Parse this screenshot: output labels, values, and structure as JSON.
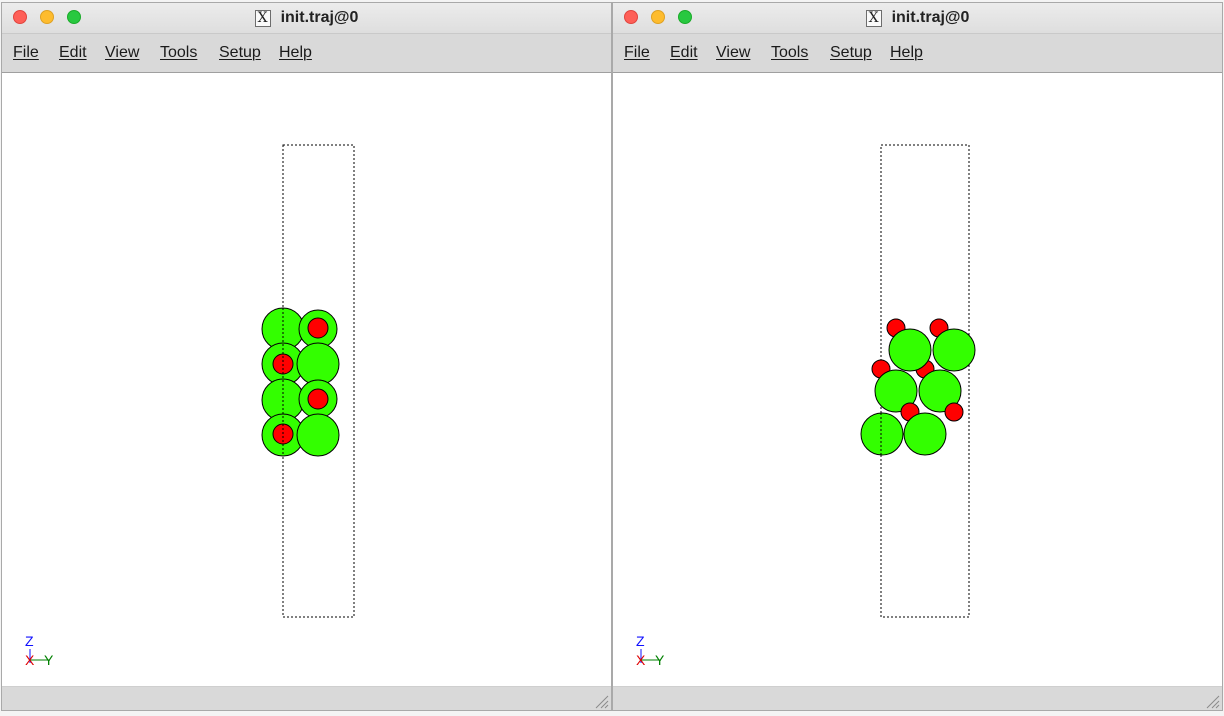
{
  "windows": {
    "left": {
      "title": "init.traj@0",
      "menu": [
        "File",
        "Edit",
        "View",
        "Tools",
        "Setup",
        "Help"
      ],
      "atoms": {
        "small_color": "#ff0000",
        "large_color": "#33ff00"
      },
      "axes": {
        "z": "Z",
        "x": "X",
        "y": "Y"
      }
    },
    "right": {
      "title": "init.traj@0",
      "menu": [
        "File",
        "Edit",
        "View",
        "Tools",
        "Setup",
        "Help"
      ],
      "atoms": {
        "small_color": "#ff0000",
        "large_color": "#33ff00"
      },
      "axes": {
        "z": "Z",
        "x": "X",
        "y": "Y"
      }
    }
  },
  "colors": {
    "close": "#fe5f57",
    "minimize": "#febc2e",
    "maximize": "#28c840",
    "axis_z": "#1010ff",
    "axis_x": "#e00000",
    "axis_y": "#008000"
  },
  "icons": [
    "x11-icon",
    "resize-grip-icon"
  ]
}
